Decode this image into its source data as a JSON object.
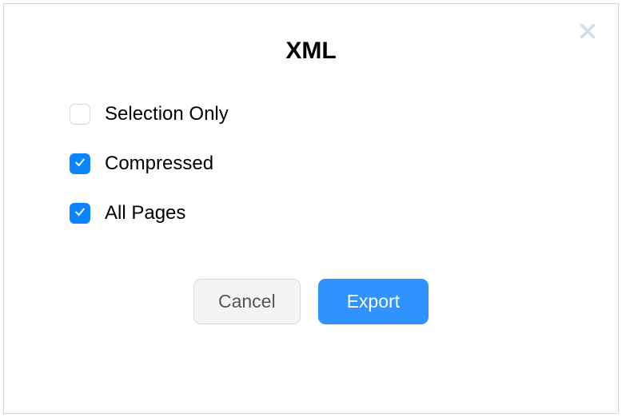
{
  "dialog": {
    "title": "XML",
    "options": {
      "selection_only": {
        "label": "Selection Only",
        "checked": false
      },
      "compressed": {
        "label": "Compressed",
        "checked": true
      },
      "all_pages": {
        "label": "All Pages",
        "checked": true
      }
    },
    "buttons": {
      "cancel": "Cancel",
      "export": "Export"
    }
  }
}
